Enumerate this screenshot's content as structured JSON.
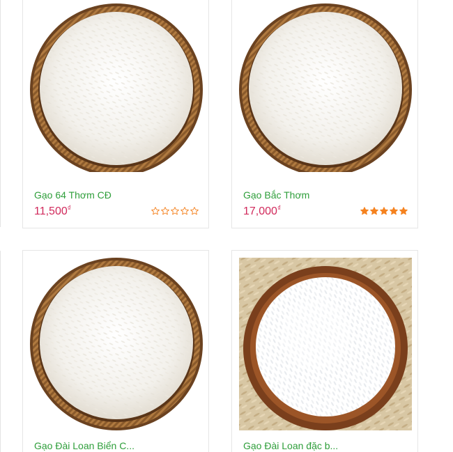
{
  "products": [
    {
      "name": "Gạo 64 Thơm CĐ",
      "price": "11,500",
      "currency": "₫",
      "rating": 0,
      "rating_max": 5,
      "image": "rice-basket-icon"
    },
    {
      "name": "Gạo Bắc Thơm",
      "price": "17,000",
      "currency": "₫",
      "rating": 5,
      "rating_max": 5,
      "image": "rice-basket-icon"
    },
    {
      "name": "Gạo Đài Loan Biển C...",
      "image": "rice-basket-icon"
    },
    {
      "name": "Gạo Đài Loan đặc b...",
      "image": "rice-bowl-icon"
    }
  ],
  "colors": {
    "title": "#2e9e3a",
    "price": "#d12a5c",
    "star": "#f5821f",
    "border": "#e6e6e6"
  }
}
